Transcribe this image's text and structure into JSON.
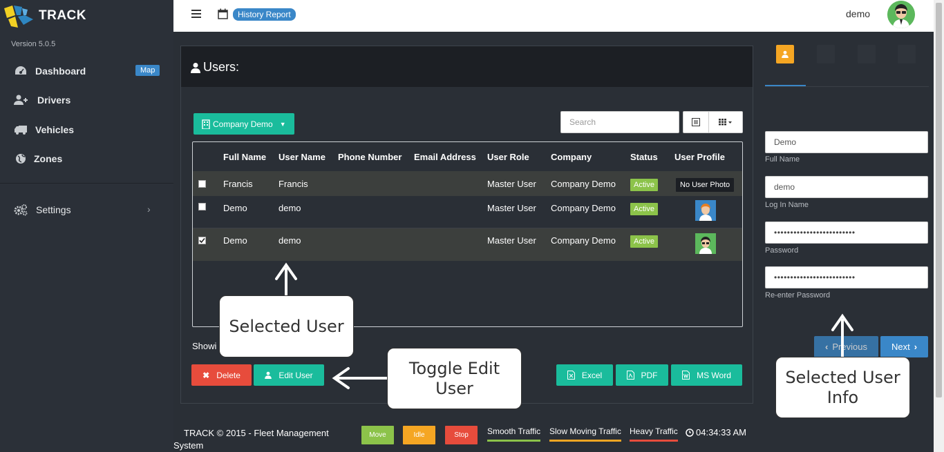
{
  "sidebar": {
    "brand": "TRACK",
    "version": "Version 5.0.5",
    "items": [
      {
        "label": "Dashboard",
        "badge": "Map",
        "icon": "dashboard-icon"
      },
      {
        "label": "Drivers",
        "icon": "add-user-icon"
      },
      {
        "label": "Vehicles",
        "icon": "truck-icon"
      },
      {
        "label": "Zones",
        "icon": "globe-icon"
      }
    ],
    "settings_label": "Settings"
  },
  "topbar": {
    "history_label": "History Report",
    "username": "demo"
  },
  "panel": {
    "title": "Users:",
    "company_button": "Company Demo",
    "search_placeholder": "Search",
    "columns": [
      "Full Name",
      "User Name",
      "Phone Number",
      "Email Address",
      "User Role",
      "Company",
      "Status",
      "User Profile"
    ],
    "rows": [
      {
        "checked": false,
        "full_name": "Francis",
        "user_name": "Francis",
        "phone": "",
        "email": "",
        "role": "Master User",
        "company": "Company Demo",
        "status": "Active",
        "profile": "No User Photo"
      },
      {
        "checked": false,
        "full_name": "Demo",
        "user_name": "demo",
        "phone": "",
        "email": "",
        "role": "Master User",
        "company": "Company Demo",
        "status": "Active",
        "profile": ""
      },
      {
        "checked": true,
        "full_name": "Demo",
        "user_name": "demo",
        "phone": "",
        "email": "",
        "role": "Master User",
        "company": "Company Demo",
        "status": "Active",
        "profile": ""
      }
    ],
    "showing_text": "Showi",
    "delete_label": "Delete",
    "edit_label": "Edit User",
    "excel_label": "Excel",
    "pdf_label": "PDF",
    "word_label": "MS Word"
  },
  "footer": {
    "copyright": "TRACK © 2015 - Fleet Management System",
    "move": "Move",
    "idle": "Idle",
    "stop": "Stop",
    "smooth": "Smooth Traffic",
    "slow": "Slow Moving Traffic",
    "heavy": "Heavy Traffic",
    "time": "04:34:33 AM"
  },
  "right_panel": {
    "full_name_value": "Demo",
    "full_name_label": "Full Name",
    "login_value": "demo",
    "login_label": "Log In Name",
    "password_value": "•••••••••••••••••••••••••",
    "password_label": "Password",
    "reenter_value": "•••••••••••••••••••••••••",
    "reenter_label": "Re-enter Password",
    "previous_label": "Previous",
    "next_label": "Next"
  },
  "callouts": {
    "selected_user": "Selected User",
    "toggle_edit": "Toggle Edit User",
    "selected_info": "Selected User Info"
  },
  "colors": {
    "accent_green": "#1abc9c",
    "accent_blue": "#3a87c8",
    "danger_red": "#e74c3c",
    "active_green": "#8cc34a",
    "idle_orange": "#f5a623"
  }
}
